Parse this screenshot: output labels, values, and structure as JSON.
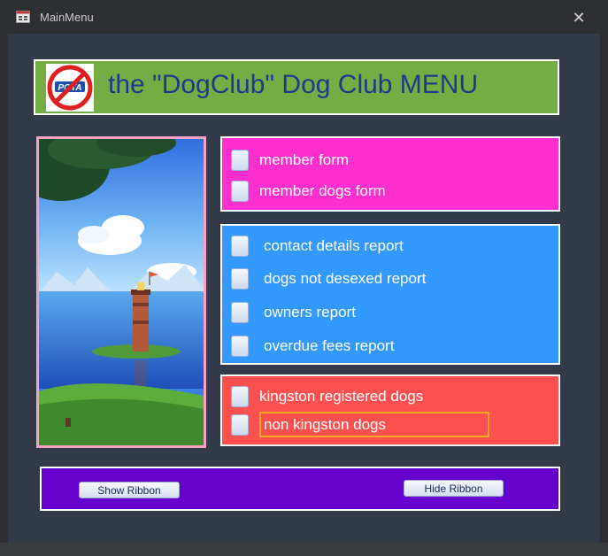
{
  "window": {
    "title": "MainMenu",
    "close_glyph": "✕"
  },
  "header": {
    "title": "the \"DogClub\" Dog Club MENU",
    "logo_text": "POTA",
    "logo_icon": "no-dogs-logo-icon"
  },
  "forms": [
    {
      "label": "member form"
    },
    {
      "label": "member dogs form"
    }
  ],
  "reports": [
    {
      "label": "contact details report"
    },
    {
      "label": "dogs not desexed report"
    },
    {
      "label": "owners report"
    },
    {
      "label": "overdue fees report"
    }
  ],
  "queries": [
    {
      "label": "kingston registered dogs"
    },
    {
      "label": "non kingston dogs"
    }
  ],
  "ribbon": {
    "show_label": "Show Ribbon",
    "hide_label": "Hide Ribbon"
  },
  "colors": {
    "header_bg": "#75ad45",
    "header_text": "#1f3a8a",
    "forms_bg": "#ff2fcf",
    "reports_bg": "#3399ff",
    "queries_bg": "#ff5050",
    "ribbon_bg": "#6600cc",
    "focus": "#f5a623"
  }
}
